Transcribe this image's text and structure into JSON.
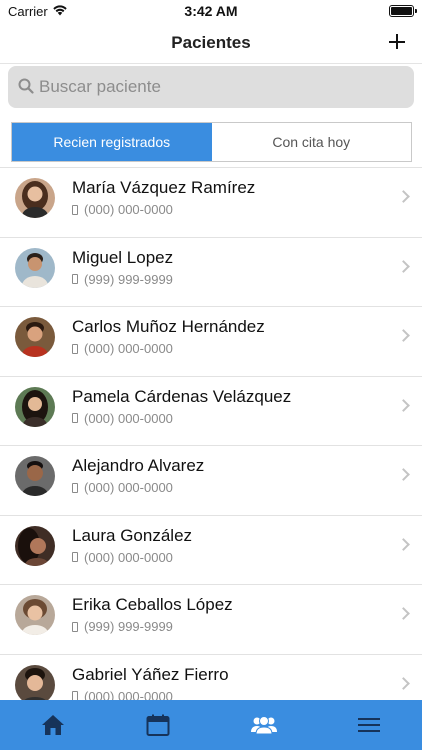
{
  "status_bar": {
    "carrier": "Carrier",
    "time": "3:42 AM"
  },
  "nav": {
    "title": "Pacientes",
    "add_icon": "plus-icon"
  },
  "search": {
    "placeholder": "Buscar paciente",
    "value": "",
    "icon": "search-icon"
  },
  "segments": [
    {
      "label": "Recien registrados",
      "active": true
    },
    {
      "label": "Con cita hoy",
      "active": false
    }
  ],
  "patients": [
    {
      "name": "María Vázquez Ramírez",
      "phone": "(000) 000-0000",
      "avatar_bg": "#c9a58a"
    },
    {
      "name": "Miguel Lopez",
      "phone": "(999) 999-9999",
      "avatar_bg": "#9fb8c9"
    },
    {
      "name": "Carlos Muñoz Hernández",
      "phone": "(000) 000-0000",
      "avatar_bg": "#7a5a3c"
    },
    {
      "name": "Pamela Cárdenas Velázquez",
      "phone": "(000) 000-0000",
      "avatar_bg": "#5d7a54"
    },
    {
      "name": "Alejandro Alvarez",
      "phone": "(000) 000-0000",
      "avatar_bg": "#6b6b6b"
    },
    {
      "name": "Laura González",
      "phone": "(000) 000-0000",
      "avatar_bg": "#3f2d25"
    },
    {
      "name": "Erika Ceballos López",
      "phone": "(999) 999-9999",
      "avatar_bg": "#b8a899"
    },
    {
      "name": "Gabriel Yáñez Fierro",
      "phone": "(000) 000-0000",
      "avatar_bg": "#5a4a3e"
    }
  ],
  "tab_bar": {
    "background": "#3a8de0",
    "items": [
      {
        "icon": "home-icon"
      },
      {
        "icon": "calendar-icon"
      },
      {
        "icon": "patients-icon",
        "active": true
      },
      {
        "icon": "menu-icon"
      }
    ]
  },
  "accent_color": "#3a8de0"
}
